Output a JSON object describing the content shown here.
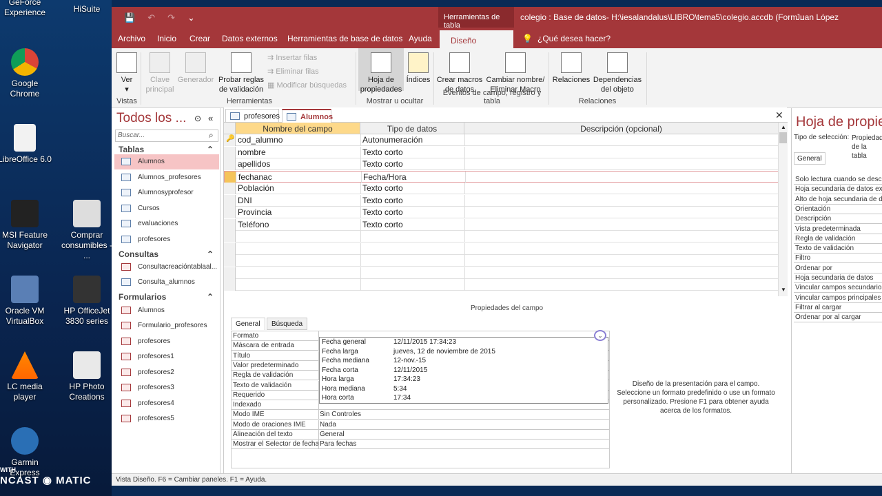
{
  "desktop": {
    "icons": [
      {
        "label": "GeForce Experience"
      },
      {
        "label": "HiSuite"
      },
      {
        "label": "Google Chrome"
      },
      {
        "label": "LibreOffice 6.0"
      },
      {
        "label": "MSI Feature Navigator"
      },
      {
        "label": "Comprar consumibles - ..."
      },
      {
        "label": "Oracle VM VirtualBox"
      },
      {
        "label": "HP OfficeJet 3830 series"
      },
      {
        "label": "LC media player"
      },
      {
        "label": "HP Photo Creations"
      },
      {
        "label": "Garmin Express"
      }
    ],
    "watermark": "NCAST ◉ MATIC",
    "watermark_prefix": "WITH"
  },
  "titlebar": {
    "context_tab": "Herramientas de tabla",
    "doc_title": "colegio : Base de datos- H:\\iesalandalus\\LIBRO\\tema5\\colegio.accdb (Form...",
    "user": "Juan López",
    "qat": [
      "💾",
      "↶",
      "↷",
      "⌄"
    ]
  },
  "tabs": [
    "Archivo",
    "Inicio",
    "Crear",
    "Datos externos",
    "Herramientas de base de datos",
    "Ayuda",
    "Diseño",
    "¿Qué desea hacer?"
  ],
  "ribbon": {
    "ver": "Ver",
    "clave": "Clave principal",
    "generador": "Generador",
    "probar": "Probar reglas de validación",
    "insertar": "Insertar filas",
    "eliminar": "Eliminar filas",
    "modificar": "Modificar búsquedas",
    "hoja": "Hoja de propiedades",
    "indices": "Índices",
    "crear_macros": "Crear macros de datos",
    "cambiar": "Cambiar nombre/ Eliminar Macro",
    "relaciones": "Relaciones",
    "dependencias": "Dependencias del objeto",
    "groups": [
      "Vistas",
      "Herramientas",
      "Mostrar u ocultar",
      "Eventos de campo, registro y tabla",
      "Relaciones"
    ]
  },
  "nav": {
    "title": "Todos los ...",
    "search_placeholder": "Buscar...",
    "sections": [
      {
        "name": "Tablas",
        "items": [
          "Alumnos",
          "Alumnos_profesores",
          "Alumnosyprofesor",
          "Cursos",
          "evaluaciones",
          "profesores"
        ]
      },
      {
        "name": "Consultas",
        "items": [
          "Consultacreacióntablaal...",
          "Consulta_alumnos"
        ]
      },
      {
        "name": "Formularios",
        "items": [
          "Alumnos",
          "Formulario_profesores",
          "profesores",
          "profesores1",
          "profesores2",
          "profesores3",
          "profesores4",
          "profesores5"
        ]
      }
    ]
  },
  "doctabs": [
    "profesores",
    "Alumnos"
  ],
  "grid": {
    "headers": [
      "Nombre del campo",
      "Tipo de datos",
      "Descripción (opcional)"
    ],
    "rows": [
      [
        "cod_alumno",
        "Autonumeración"
      ],
      [
        "nombre",
        "Texto corto"
      ],
      [
        "apellidos",
        "Texto corto"
      ],
      [
        "fechanac",
        "Fecha/Hora"
      ],
      [
        "Población",
        "Texto corto"
      ],
      [
        "DNI",
        "Texto corto"
      ],
      [
        "Provincia",
        "Texto corto"
      ],
      [
        "Teléfono",
        "Texto corto"
      ]
    ]
  },
  "field_props": {
    "caption": "Propiedades del campo",
    "tabs": [
      "General",
      "Búsqueda"
    ],
    "rows": [
      [
        "Formato",
        ""
      ],
      [
        "Máscara de entrada",
        ""
      ],
      [
        "Título",
        ""
      ],
      [
        "Valor predeterminado",
        ""
      ],
      [
        "Regla de validación",
        ""
      ],
      [
        "Texto de validación",
        ""
      ],
      [
        "Requerido",
        ""
      ],
      [
        "Indexado",
        ""
      ],
      [
        "Modo IME",
        "Sin Controles"
      ],
      [
        "Modo de oraciones IME",
        "Nada"
      ],
      [
        "Alineación del texto",
        "General"
      ],
      [
        "Mostrar el Selector de fecha",
        "Para fechas"
      ]
    ],
    "dropdown": [
      [
        "Fecha general",
        "12/11/2015 17:34:23"
      ],
      [
        "Fecha larga",
        "jueves, 12 de noviembre de 2015"
      ],
      [
        "Fecha mediana",
        "12-nov.-15"
      ],
      [
        "Fecha corta",
        "12/11/2015"
      ],
      [
        "Hora larga",
        "17:34:23"
      ],
      [
        "Hora mediana",
        "5:34"
      ],
      [
        "Hora corta",
        "17:34"
      ]
    ],
    "help": "Diseño de la presentación para el campo. Seleccione un formato predefinido o use un formato personalizado. Presione F1 para obtener ayuda acerca de los formatos."
  },
  "sheet": {
    "title": "Hoja de propie",
    "type_label": "Tipo de selección:",
    "type_value": "Propiedades de la tabla",
    "tab": "General",
    "rows": [
      "Solo lectura cuando se desco",
      "Hoja secundaria de datos ex",
      "Alto de hoja secundaria de d",
      "Orientación",
      "Descripción",
      "Vista predeterminada",
      "Regla de validación",
      "Texto de validación",
      "Filtro",
      "Ordenar por",
      "Hoja secundaria de datos",
      "Vincular campos secundarios",
      "Vincular campos principales",
      "Filtrar al cargar",
      "Ordenar por al cargar"
    ]
  },
  "status": "Vista Diseño.  F6 = Cambiar paneles.  F1 = Ayuda.",
  "colors": {
    "accent": "#a4373a",
    "selected_row": "#f5c45a",
    "nav_selected": "#f6c4c5"
  }
}
